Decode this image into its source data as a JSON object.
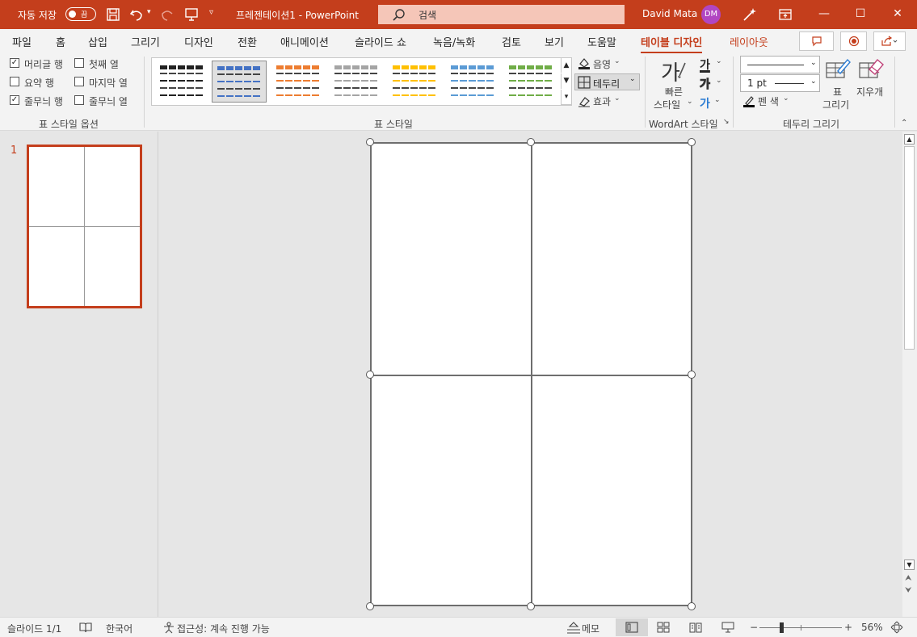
{
  "titlebar": {
    "autosave_label": "자동 저장",
    "autosave_state": "끔",
    "doc_title": "프레젠테이션1  -  PowerPoint",
    "search_placeholder": "검색",
    "user_name": "David Mata",
    "user_initials": "DM"
  },
  "tabs": [
    "파일",
    "홈",
    "삽입",
    "그리기",
    "디자인",
    "전환",
    "애니메이션",
    "슬라이드 쇼",
    "녹음/녹화",
    "검토",
    "보기",
    "도움말",
    "테이블 디자인",
    "레이아웃"
  ],
  "ribbon": {
    "style_options": {
      "items": [
        {
          "label": "머리글 행",
          "checked": true
        },
        {
          "label": "요약 행",
          "checked": false
        },
        {
          "label": "줄무늬 행",
          "checked": true
        },
        {
          "label": "첫째 열",
          "checked": false
        },
        {
          "label": "마지막 열",
          "checked": false
        },
        {
          "label": "줄무늬 열",
          "checked": false
        }
      ],
      "group_label": "표 스타일 옵션"
    },
    "table_styles": {
      "group_label": "표 스타일",
      "shading": "음영",
      "borders": "테두리",
      "effects": "효과",
      "swatches": [
        "#222222",
        "#4472c4",
        "#ed7d31",
        "#a5a5a5",
        "#ffc000",
        "#5b9bd5",
        "#70ad47"
      ]
    },
    "wordart": {
      "group_label": "WordArt 스타일",
      "quick_styles_line1": "빠른",
      "quick_styles_line2": "스타일",
      "glyph": "가"
    },
    "draw_borders": {
      "group_label": "테두리 그리기",
      "pen_weight": "1 pt",
      "pen_color": "펜 색",
      "draw_table_line1": "표",
      "draw_table_line2": "그리기",
      "eraser": "지우개"
    }
  },
  "slides_pane": {
    "slide_number": "1"
  },
  "status": {
    "slide_info": "슬라이드 1/1",
    "language": "한국어",
    "accessibility": "접근성: 계속 진행 가능",
    "notes": "메모",
    "zoom": "56%"
  }
}
